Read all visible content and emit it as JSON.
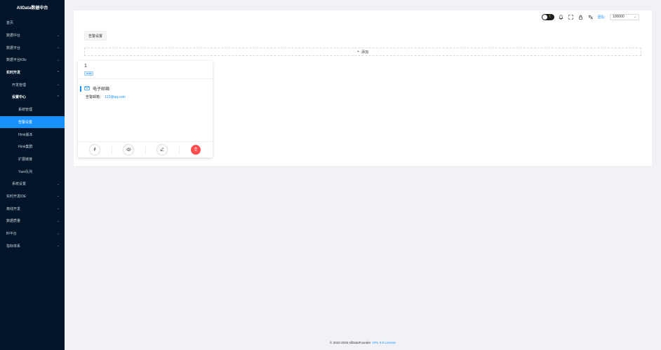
{
  "sidebar": {
    "logo": "AllData数据中台",
    "items": [
      {
        "label": "首页",
        "level": 1,
        "chevron": "",
        "bold": false,
        "active": false
      },
      {
        "label": "数据中台",
        "level": 1,
        "chevron": "down",
        "bold": false,
        "active": false
      },
      {
        "label": "数据平台",
        "level": 1,
        "chevron": "down",
        "bold": false,
        "active": false
      },
      {
        "label": "数据平台K8s",
        "level": 1,
        "chevron": "down",
        "bold": false,
        "active": false
      },
      {
        "label": "实时开发",
        "level": 1,
        "chevron": "up",
        "bold": true,
        "active": false
      },
      {
        "label": "开发管理",
        "level": 2,
        "chevron": "down",
        "bold": false,
        "active": false
      },
      {
        "label": "设置中心",
        "level": 2,
        "chevron": "up",
        "bold": true,
        "active": false
      },
      {
        "label": "系统管理",
        "level": 3,
        "chevron": "",
        "bold": false,
        "active": false
      },
      {
        "label": "告警设置",
        "level": 3,
        "chevron": "",
        "bold": false,
        "active": true
      },
      {
        "label": "Flink版本",
        "level": 3,
        "chevron": "",
        "bold": false,
        "active": false
      },
      {
        "label": "Flink集群",
        "level": 3,
        "chevron": "",
        "bold": false,
        "active": false
      },
      {
        "label": "扩展链接",
        "level": 3,
        "chevron": "",
        "bold": false,
        "active": false
      },
      {
        "label": "Yarn队列",
        "level": 3,
        "chevron": "",
        "bold": false,
        "active": false
      },
      {
        "label": "系统设置",
        "level": 2,
        "chevron": "down",
        "bold": false,
        "active": false
      },
      {
        "label": "实时开发IDE",
        "level": 1,
        "chevron": "down",
        "bold": false,
        "active": false
      },
      {
        "label": "离线开发",
        "level": 1,
        "chevron": "down",
        "bold": false,
        "active": false
      },
      {
        "label": "数据质量",
        "level": 1,
        "chevron": "down",
        "bold": false,
        "active": false
      },
      {
        "label": "BI平台",
        "level": 1,
        "chevron": "down",
        "bold": false,
        "active": false
      },
      {
        "label": "指标体系",
        "level": 1,
        "chevron": "down",
        "bold": false,
        "active": false
      }
    ]
  },
  "header": {
    "tenant_label": "团队:",
    "tenant_value": "100000"
  },
  "main": {
    "tab_label": "告警设置",
    "add_label": "添加",
    "card": {
      "title": "1",
      "tag": "mail",
      "channel_name": "电子邮箱",
      "field_key": "告警邮箱：",
      "field_value": "123@qq.com"
    }
  },
  "footer": {
    "copyright": "© 2022-2025 AllDataFounder",
    "license": "GPL-3.0 License"
  },
  "colors": {
    "sidebar_bg": "#001529",
    "accent": "#1890ff",
    "danger": "#ff4d4f"
  }
}
